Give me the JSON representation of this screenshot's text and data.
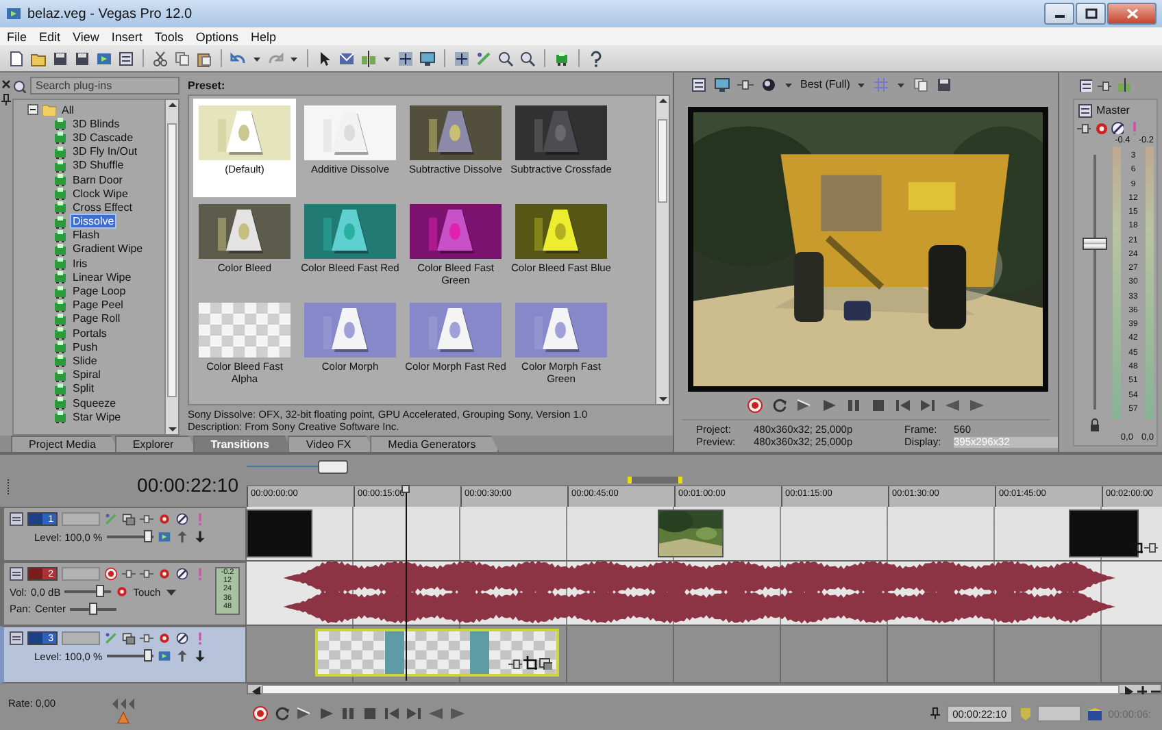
{
  "window": {
    "title": "belaz.veg - Vegas Pro 12.0"
  },
  "menu": [
    "File",
    "Edit",
    "View",
    "Insert",
    "Tools",
    "Options",
    "Help"
  ],
  "plugins": {
    "search": {
      "placeholder": "Search plug-ins"
    },
    "tree": [
      {
        "label": "All",
        "expanded": true,
        "selected": false,
        "children": [
          {
            "label": "3D Blinds",
            "selected": false
          },
          {
            "label": "3D Cascade",
            "selected": false
          },
          {
            "label": "3D Fly In/Out",
            "selected": false
          },
          {
            "label": "3D Shuffle",
            "selected": false
          },
          {
            "label": "Barn Door",
            "selected": false
          },
          {
            "label": "Clock Wipe",
            "selected": false
          },
          {
            "label": "Cross Effect",
            "selected": false
          },
          {
            "label": "Dissolve",
            "selected": true
          },
          {
            "label": "Flash",
            "selected": false
          },
          {
            "label": "Gradient Wipe",
            "selected": false
          },
          {
            "label": "Iris",
            "selected": false
          },
          {
            "label": "Linear Wipe",
            "selected": false
          },
          {
            "label": "Page Loop",
            "selected": false
          },
          {
            "label": "Page Peel",
            "selected": false
          },
          {
            "label": "Page Roll",
            "selected": false
          },
          {
            "label": "Portals",
            "selected": false
          },
          {
            "label": "Push",
            "selected": false
          },
          {
            "label": "Slide",
            "selected": false
          },
          {
            "label": "Spiral",
            "selected": false
          },
          {
            "label": "Split",
            "selected": false
          },
          {
            "label": "Squeeze",
            "selected": false
          },
          {
            "label": "Star Wipe",
            "selected": false
          }
        ]
      }
    ]
  },
  "presets": {
    "header": "Preset:",
    "items": [
      {
        "label": "(Default)",
        "selected": true
      },
      {
        "label": "Additive Dissolve",
        "selected": false
      },
      {
        "label": "Subtractive Dissolve",
        "selected": false
      },
      {
        "label": "Subtractive Crossfade",
        "selected": false
      },
      {
        "label": "Color Bleed",
        "selected": false
      },
      {
        "label": "Color Bleed Fast Red",
        "selected": false
      },
      {
        "label": "Color Bleed Fast Green",
        "selected": false
      },
      {
        "label": "Color Bleed Fast Blue",
        "selected": false
      },
      {
        "label": "Color Bleed Fast Alpha",
        "selected": false
      },
      {
        "label": "Color Morph",
        "selected": false
      },
      {
        "label": "Color Morph Fast Red",
        "selected": false
      },
      {
        "label": "Color Morph Fast Green",
        "selected": false
      }
    ],
    "description": [
      "Sony Dissolve: OFX, 32-bit floating point, GPU Accelerated, Grouping Sony, Version 1.0",
      "Description: From Sony Creative Software Inc."
    ]
  },
  "tabs": [
    {
      "label": "Project Media",
      "selected": false
    },
    {
      "label": "Explorer",
      "selected": false
    },
    {
      "label": "Transitions",
      "selected": true
    },
    {
      "label": "Video FX",
      "selected": false
    },
    {
      "label": "Media Generators",
      "selected": false
    }
  ],
  "preview": {
    "quality": "Best (Full)",
    "info": [
      {
        "label": "Project:",
        "value": "480x360x32; 25,000p"
      },
      {
        "label": "Frame:",
        "value": "560"
      },
      {
        "label": "Preview:",
        "value": "480x360x32; 25,000p"
      },
      {
        "label": "Display:",
        "value": "395x296x32"
      }
    ]
  },
  "master": {
    "title": "Master",
    "peaks": [
      "-0.4",
      "-0.2"
    ],
    "scale": [
      "3",
      "6",
      "9",
      "12",
      "15",
      "18",
      "21",
      "24",
      "27",
      "30",
      "33",
      "36",
      "39",
      "42",
      "45",
      "48",
      "51",
      "54",
      "57"
    ],
    "readouts": [
      "0,0",
      "0,0"
    ],
    "level": 0.65
  },
  "timeline": {
    "time": "00:00:22:10",
    "ruler": [
      "00:00:00:00",
      "00:00:15:00",
      "00:00:30:00",
      "00:00:45:00",
      "00:01:00:00",
      "00:01:15:00",
      "00:01:30:00",
      "00:01:45:00",
      "00:02:00:00"
    ],
    "tracks": [
      {
        "kind": "video",
        "number": "1",
        "selected": false,
        "level_label": "Level: 100,0 %",
        "level": 0.9
      },
      {
        "kind": "audio",
        "number": "2",
        "selected": false,
        "volume": {
          "label": "Vol:",
          "value": "0,0 dB",
          "level": 0.75
        },
        "pan": {
          "label": "Pan:",
          "value": "Center",
          "level": 0.5
        },
        "mode": "Touch",
        "peak": "-0.2",
        "scale": [
          "12",
          "24",
          "36",
          "48"
        ]
      },
      {
        "kind": "video",
        "number": "3",
        "selected": true,
        "level_label": "Level: 100,0 %",
        "level": 0.9
      }
    ],
    "rate": "Rate: 0,00"
  },
  "transport": {
    "time": "00:00:22:10",
    "end_time": "00:00:06:"
  }
}
